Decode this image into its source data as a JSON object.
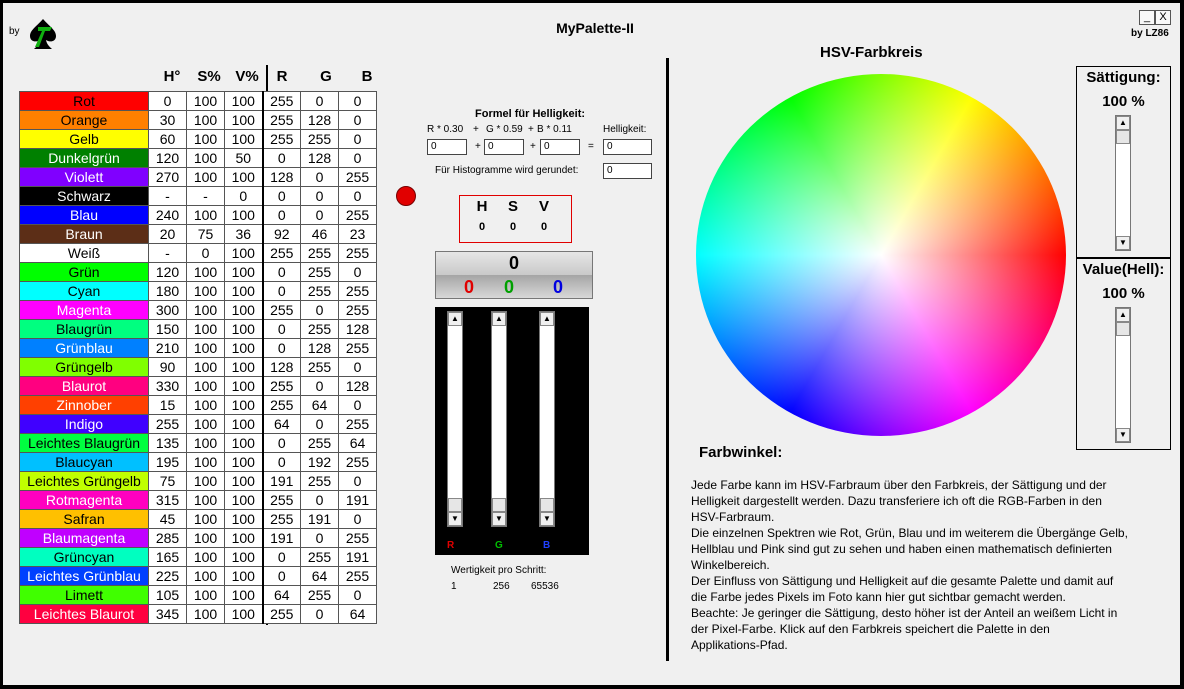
{
  "app": {
    "by_left": "by",
    "title": "MyPalette-II",
    "by_right": "by LZ86",
    "btn_min": "_",
    "btn_close": "X"
  },
  "table": {
    "headers": [
      "H°",
      "S%",
      "V%",
      "R",
      "G",
      "B"
    ],
    "rows": [
      {
        "name": "Rot",
        "bg": "#ff0000",
        "fg": "#000000",
        "h": "0",
        "s": "100",
        "v": "100",
        "r": "255",
        "g": "0",
        "b": "0"
      },
      {
        "name": "Orange",
        "bg": "#ff8000",
        "fg": "#000000",
        "h": "30",
        "s": "100",
        "v": "100",
        "r": "255",
        "g": "128",
        "b": "0"
      },
      {
        "name": "Gelb",
        "bg": "#ffff00",
        "fg": "#000000",
        "h": "60",
        "s": "100",
        "v": "100",
        "r": "255",
        "g": "255",
        "b": "0"
      },
      {
        "name": "Dunkelgrün",
        "bg": "#008000",
        "fg": "#ffffff",
        "h": "120",
        "s": "100",
        "v": "50",
        "r": "0",
        "g": "128",
        "b": "0"
      },
      {
        "name": "Violett",
        "bg": "#8000ff",
        "fg": "#ffffff",
        "h": "270",
        "s": "100",
        "v": "100",
        "r": "128",
        "g": "0",
        "b": "255"
      },
      {
        "name": "Schwarz",
        "bg": "#000000",
        "fg": "#ffffff",
        "h": "-",
        "s": "-",
        "v": "0",
        "r": "0",
        "g": "0",
        "b": "0"
      },
      {
        "name": "Blau",
        "bg": "#0000ff",
        "fg": "#ffffff",
        "h": "240",
        "s": "100",
        "v": "100",
        "r": "0",
        "g": "0",
        "b": "255"
      },
      {
        "name": "Braun",
        "bg": "#5c2e17",
        "fg": "#ffffff",
        "h": "20",
        "s": "75",
        "v": "36",
        "r": "92",
        "g": "46",
        "b": "23"
      },
      {
        "name": "Weiß",
        "bg": "#ffffff",
        "fg": "#000000",
        "h": "-",
        "s": "0",
        "v": "100",
        "r": "255",
        "g": "255",
        "b": "255"
      },
      {
        "name": "Grün",
        "bg": "#00ff00",
        "fg": "#000000",
        "h": "120",
        "s": "100",
        "v": "100",
        "r": "0",
        "g": "255",
        "b": "0"
      },
      {
        "name": "Cyan",
        "bg": "#00ffff",
        "fg": "#000000",
        "h": "180",
        "s": "100",
        "v": "100",
        "r": "0",
        "g": "255",
        "b": "255"
      },
      {
        "name": "Magenta",
        "bg": "#ff00ff",
        "fg": "#ffffff",
        "h": "300",
        "s": "100",
        "v": "100",
        "r": "255",
        "g": "0",
        "b": "255"
      },
      {
        "name": "Blaugrün",
        "bg": "#00ff80",
        "fg": "#000000",
        "h": "150",
        "s": "100",
        "v": "100",
        "r": "0",
        "g": "255",
        "b": "128"
      },
      {
        "name": "Grünblau",
        "bg": "#0080ff",
        "fg": "#ffffff",
        "h": "210",
        "s": "100",
        "v": "100",
        "r": "0",
        "g": "128",
        "b": "255"
      },
      {
        "name": "Grüngelb",
        "bg": "#80ff00",
        "fg": "#000000",
        "h": "90",
        "s": "100",
        "v": "100",
        "r": "128",
        "g": "255",
        "b": "0"
      },
      {
        "name": "Blaurot",
        "bg": "#ff0080",
        "fg": "#ffffff",
        "h": "330",
        "s": "100",
        "v": "100",
        "r": "255",
        "g": "0",
        "b": "128"
      },
      {
        "name": "Zinnober",
        "bg": "#ff4000",
        "fg": "#ffffff",
        "h": "15",
        "s": "100",
        "v": "100",
        "r": "255",
        "g": "64",
        "b": "0"
      },
      {
        "name": "Indigo",
        "bg": "#4000ff",
        "fg": "#ffffff",
        "h": "255",
        "s": "100",
        "v": "100",
        "r": "64",
        "g": "0",
        "b": "255"
      },
      {
        "name": "Leichtes Blaugrün",
        "bg": "#00ff40",
        "fg": "#000000",
        "h": "135",
        "s": "100",
        "v": "100",
        "r": "0",
        "g": "255",
        "b": "64"
      },
      {
        "name": "Blaucyan",
        "bg": "#00c0ff",
        "fg": "#000000",
        "h": "195",
        "s": "100",
        "v": "100",
        "r": "0",
        "g": "192",
        "b": "255"
      },
      {
        "name": "Leichtes Grüngelb",
        "bg": "#c0ff00",
        "fg": "#000000",
        "h": "75",
        "s": "100",
        "v": "100",
        "r": "191",
        "g": "255",
        "b": "0"
      },
      {
        "name": "Rotmagenta",
        "bg": "#ff00c0",
        "fg": "#ffffff",
        "h": "315",
        "s": "100",
        "v": "100",
        "r": "255",
        "g": "0",
        "b": "191"
      },
      {
        "name": "Safran",
        "bg": "#ffc000",
        "fg": "#000000",
        "h": "45",
        "s": "100",
        "v": "100",
        "r": "255",
        "g": "191",
        "b": "0"
      },
      {
        "name": "Blaumagenta",
        "bg": "#c000ff",
        "fg": "#ffffff",
        "h": "285",
        "s": "100",
        "v": "100",
        "r": "191",
        "g": "0",
        "b": "255"
      },
      {
        "name": "Grüncyan",
        "bg": "#00ffc0",
        "fg": "#000000",
        "h": "165",
        "s": "100",
        "v": "100",
        "r": "0",
        "g": "255",
        "b": "191"
      },
      {
        "name": "Leichtes Grünblau",
        "bg": "#0040ff",
        "fg": "#ffffff",
        "h": "225",
        "s": "100",
        "v": "100",
        "r": "0",
        "g": "64",
        "b": "255"
      },
      {
        "name": "Limett",
        "bg": "#40ff00",
        "fg": "#000000",
        "h": "105",
        "s": "100",
        "v": "100",
        "r": "64",
        "g": "255",
        "b": "0"
      },
      {
        "name": "Leichtes Blaurot",
        "bg": "#ff0040",
        "fg": "#ffffff",
        "h": "345",
        "s": "100",
        "v": "100",
        "r": "255",
        "g": "0",
        "b": "64"
      }
    ]
  },
  "formula": {
    "title": "Formel für Helligkeit:",
    "r_coef": "R * 0.30",
    "plus1": "+",
    "g_coef": "G * 0.59",
    "plus2": "+",
    "b_coef": "B  * 0.11",
    "hell_label": "Helligkeit:",
    "r_val": "0",
    "op1": "+",
    "g_val": "0",
    "op2": "+",
    "b_val": "0",
    "eq": "=",
    "hell_val": "0",
    "hist_label": "Für Histogramme wird gerundet:",
    "hist_val": "0"
  },
  "hsv": {
    "h_label": "H",
    "s_label": "S",
    "v_label": "V",
    "h_val": "0",
    "s_val": "0",
    "v_val": "0"
  },
  "display": {
    "value": "0",
    "r": "0",
    "g": "0",
    "b": "0",
    "r_color": "#e00000",
    "g_color": "#00a000",
    "b_color": "#0000e0"
  },
  "sliders": {
    "r_label": "R",
    "g_label": "G",
    "b_label": "B",
    "up": "▲",
    "down": "▼",
    "wert_label": "Wertigkeit pro Schritt:",
    "w1": "1",
    "w2": "256",
    "w3": "65536"
  },
  "right": {
    "wheel_title": "HSV-Farbkreis",
    "sat_title": "Sättigung:",
    "sat_val": "100 %",
    "val_title": "Value(Hell):",
    "val_val": "100 %",
    "farbwinkel": "Farbwinkel:",
    "description": "Jede Farbe kann im HSV-Farbraum über den Farbkreis, der Sättigung und der\nHelligkeit dargestellt werden. Dazu transferiere ich oft die RGB-Farben in den\nHSV-Farbraum.\nDie einzelnen Spektren wie Rot, Grün, Blau und im weiterem die Übergänge Gelb,\nHellblau und Pink sind gut zu sehen und haben einen mathematisch definierten\nWinkelbereich.\nDer Einfluss von Sättigung und Helligkeit auf die gesamte Palette und damit auf\ndie Farbe jedes Pixels im Foto kann hier gut sichtbar gemacht werden.\nBeachte: Je geringer die Sättigung, desto höher ist der Anteil an weißem Licht in\nder Pixel-Farbe. Klick auf den Farbkreis speichert die Palette in den\nApplikations-Pfad."
  }
}
